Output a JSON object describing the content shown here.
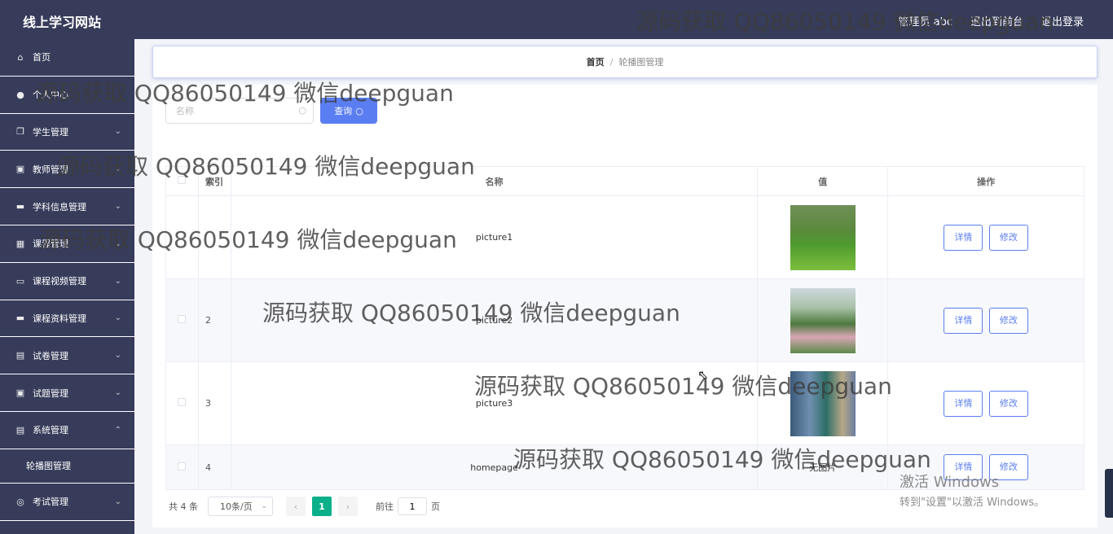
{
  "header": {
    "site_title": "线上学习网站",
    "admin_label": "管理员 abc",
    "exit_to_front": "退出到前台",
    "logout": "退出登录"
  },
  "sidebar": {
    "items": [
      {
        "label": "首页",
        "icon": "home-icon",
        "glyph": "⌂"
      },
      {
        "label": "个人中心",
        "icon": "user-icon",
        "glyph": "●"
      },
      {
        "label": "学生管理",
        "icon": "copy-icon",
        "glyph": "❐"
      },
      {
        "label": "教师管理",
        "icon": "clipboard-icon",
        "glyph": "▣"
      },
      {
        "label": "学科信息管理",
        "icon": "flag-icon",
        "glyph": "▬"
      },
      {
        "label": "课程管理",
        "icon": "grid-icon",
        "glyph": "▦"
      },
      {
        "label": "课程视频管理",
        "icon": "chat-icon",
        "glyph": "▭"
      },
      {
        "label": "课程资料管理",
        "icon": "monitor-icon",
        "glyph": "▬"
      },
      {
        "label": "试卷管理",
        "icon": "printer-icon",
        "glyph": "▤"
      },
      {
        "label": "试题管理",
        "icon": "check-doc-icon",
        "glyph": "▣"
      },
      {
        "label": "系统管理",
        "icon": "settings-icon",
        "glyph": "▤"
      },
      {
        "label": "考试管理",
        "icon": "compass-icon",
        "glyph": "◎"
      }
    ],
    "submenu_label": "轮播图管理",
    "chevron_down": "⌄",
    "chevron_up": "⌃"
  },
  "breadcrumb": {
    "home": "首页",
    "sep": "/",
    "current": "轮播图管理"
  },
  "search": {
    "placeholder": "名称",
    "query_label": "查询",
    "search_glyph": "○"
  },
  "table": {
    "headers": {
      "index": "索引",
      "name": "名称",
      "value": "值",
      "operation": "操作"
    },
    "rows": [
      {
        "index": "",
        "name": "picture1",
        "value_img": "park-lawn-photo"
      },
      {
        "index": "2",
        "name": "picture2",
        "value_img": "garden-flowers-photo"
      },
      {
        "index": "3",
        "name": "picture3",
        "value_img": "interior-photo"
      },
      {
        "index": "4",
        "name": "homepage",
        "value_text": "无图片"
      }
    ],
    "detail_label": "详情",
    "edit_label": "修改"
  },
  "pagination": {
    "total": "共 4 条",
    "page_size": "10条/页",
    "current_page": "1",
    "goto_prefix": "前往",
    "goto_value": "1",
    "goto_suffix": "页",
    "prev_glyph": "‹",
    "next_glyph": "›"
  },
  "watermarks": {
    "text": "源码获取 QQ86050149 微信deepguan"
  },
  "windows_activation": {
    "title": "激活 Windows",
    "subtitle": "转到\"设置\"以激活 Windows。"
  },
  "colors": {
    "sidebar_bg": "#373c5a",
    "accent_blue": "#5a7ef2",
    "pager_active": "#0bb08a"
  }
}
